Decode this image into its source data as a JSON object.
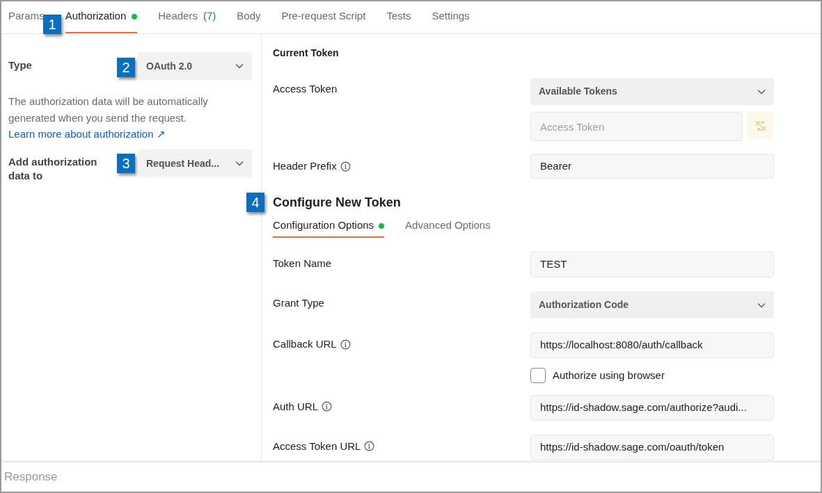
{
  "tabs": [
    {
      "label": "Params",
      "selected": false
    },
    {
      "label": "Authorization",
      "selected": true,
      "dot": true
    },
    {
      "label": "Headers",
      "count": "(7)",
      "selected": false
    },
    {
      "label": "Body",
      "selected": false
    },
    {
      "label": "Pre-request Script",
      "selected": false
    },
    {
      "label": "Tests",
      "selected": false
    },
    {
      "label": "Settings",
      "selected": false
    }
  ],
  "callouts": [
    "1",
    "2",
    "3",
    "4"
  ],
  "left": {
    "type_label": "Type",
    "type_value": "OAuth 2.0",
    "description": "The authorization data will be automatically generated when you send the request.",
    "link": "Learn more about authorization ↗",
    "add_label": "Add authorization data to",
    "add_value": "Request Head..."
  },
  "current_token": {
    "title": "Current Token",
    "access_label": "Access Token",
    "tokens_select": "Available Tokens",
    "token_placeholder": "Access Token",
    "prefix_label": "Header Prefix",
    "prefix_value": "Bearer"
  },
  "configure": {
    "title": "Configure New Token",
    "tabs": [
      {
        "label": "Configuration Options",
        "selected": true,
        "dot": true
      },
      {
        "label": "Advanced Options",
        "selected": false
      }
    ],
    "rows": [
      {
        "kind": "input",
        "label": "Token Name",
        "value": "TEST",
        "info": false
      },
      {
        "kind": "select",
        "label": "Grant Type",
        "value": "Authorization Code",
        "info": false
      },
      {
        "kind": "input",
        "label": "Callback URL",
        "value": "https://localhost:8080/auth/callback",
        "info": true
      },
      {
        "kind": "checkbox",
        "label": "Authorize using browser",
        "checked": false
      },
      {
        "kind": "input",
        "label": "Auth URL",
        "value": "https://id-shadow.sage.com/authorize?audi...",
        "info": true
      },
      {
        "kind": "input",
        "label": "Access Token URL",
        "value": "https://id-shadow.sage.com/oauth/token",
        "info": true
      }
    ]
  },
  "response": {
    "label": "Response"
  }
}
